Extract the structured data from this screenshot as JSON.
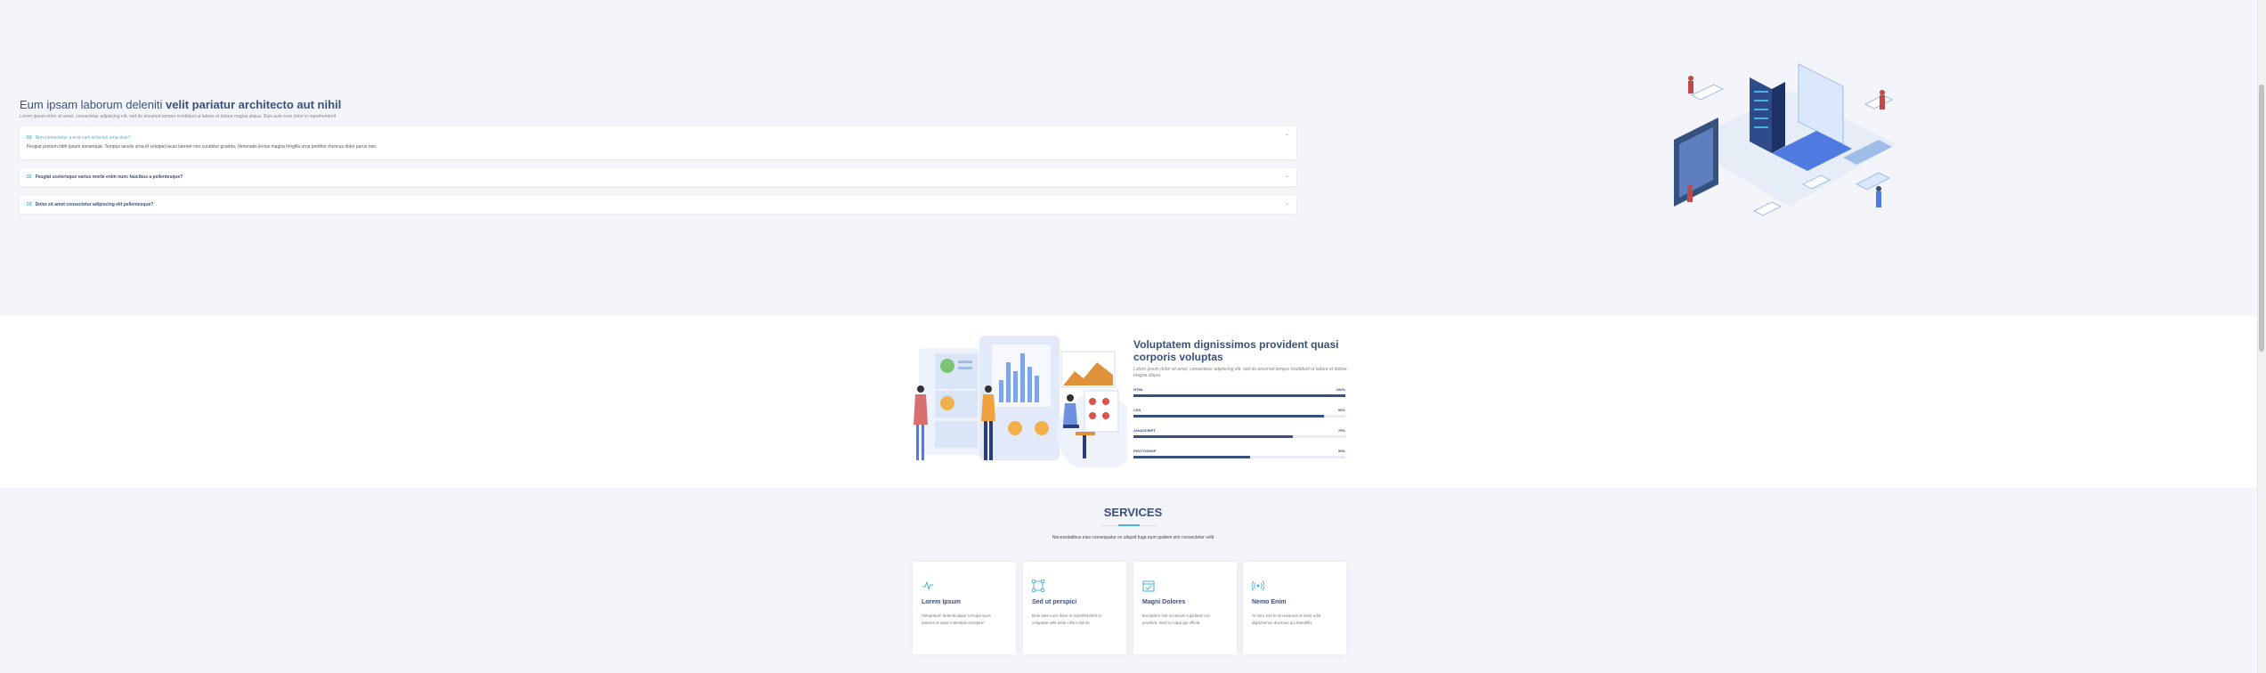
{
  "faq": {
    "title_start": "Eum ipsam laborum deleniti ",
    "title_bold": "velit pariatur architecto aut nihil",
    "subtitle": "Lorem ipsum dolor sit amet, consectetur adipiscing elit, sed do eiusmod tempor incididunt ut labore et dolore magna aliqua. Duis aute irure dolor in reprehenderit",
    "items": [
      {
        "num": "01",
        "question": "Non consectetur a erat nam at lectus urna duis?",
        "answer": "Feugiat pretium nibh ipsum consequat. Tempus iaculis urna id volutpat lacus laoreet non curabitur gravida. Venenatis lectus magna fringilla urna porttitor rhoncus dolor purus non."
      },
      {
        "num": "02",
        "question": "Feugiat scelerisque varius morbi enim nunc faucibus a pellentesque?"
      },
      {
        "num": "03",
        "question": "Dolor sit amet consectetur adipiscing elit pellentesque?"
      }
    ]
  },
  "skills": {
    "title": "Voluptatem dignissimos provident quasi corporis voluptas",
    "text": "Lorem ipsum dolor sit amet, consectetur adipiscing elit, sed do eiusmod tempor incididunt ut labore et dolore magna aliqua.",
    "items": [
      {
        "name": "HTML",
        "percent_label": "100%",
        "value": 100
      },
      {
        "name": "CSS",
        "percent_label": "90%",
        "value": 90
      },
      {
        "name": "JAVASCRIPT",
        "percent_label": "75%",
        "value": 75
      },
      {
        "name": "PHOTOSHOP",
        "percent_label": "55%",
        "value": 55
      }
    ]
  },
  "services": {
    "title": "SERVICES",
    "subtitle": "Necessitatibus eius consequatur ex aliquid fuga eum quidem sint consectetur velit",
    "cards": [
      {
        "icon": "activity-icon",
        "title": "Lorem Ipsum",
        "text": "Voluptatum deleniti atque corrupti quos dolores et quas molestias excepturi"
      },
      {
        "icon": "bounding-box-icon",
        "title": "Sed ut perspici",
        "text": "Duis aute irure dolor in reprehenderit in voluptate velit esse cillum dolore"
      },
      {
        "icon": "calendar-icon",
        "title": "Magni Dolores",
        "text": "Excepteur sint occaecat cupidatat non proident, sunt in culpa qui officia"
      },
      {
        "icon": "broadcast-icon",
        "title": "Nemo Enim",
        "text": "At vero eos et accusamus et iusto odio dignissimos ducimus qui blanditiis"
      }
    ]
  },
  "colors": {
    "primary": "#37517e",
    "accent": "#47b2e4",
    "background": "#f3f5fa"
  }
}
